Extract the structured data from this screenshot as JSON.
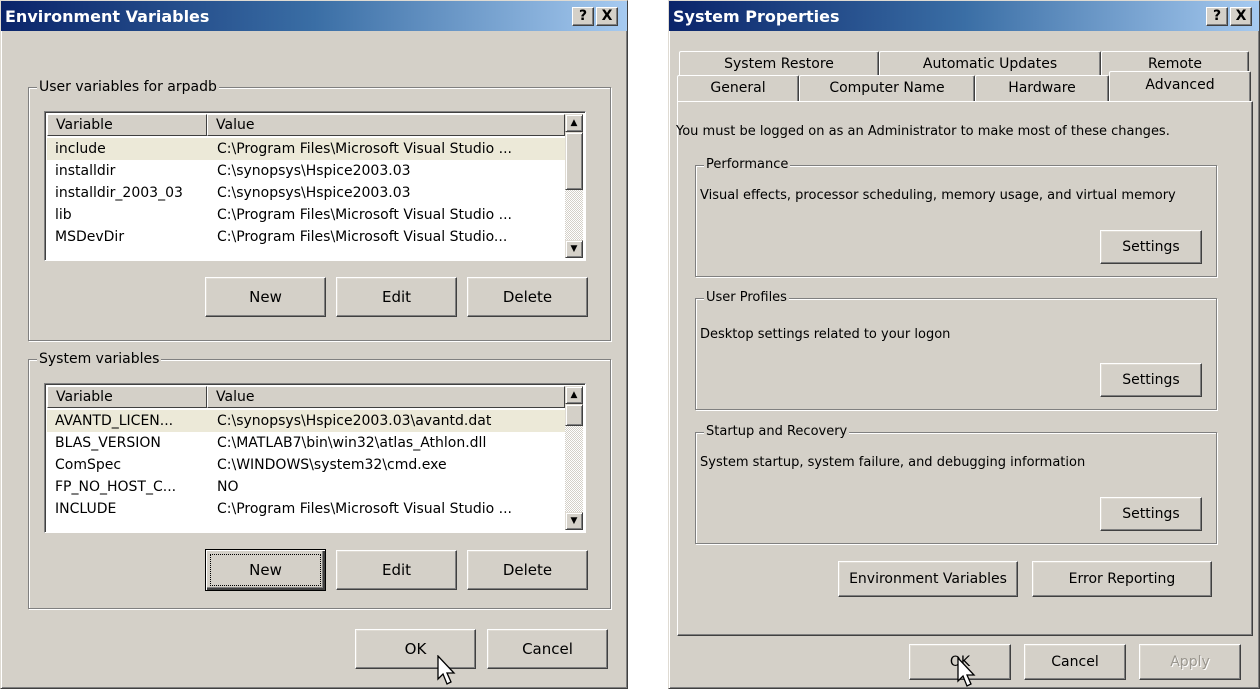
{
  "env_dialog": {
    "title": "Environment Variables",
    "help_btn": "?",
    "close_btn": "X",
    "user_group": {
      "label": "User variables for arpadb",
      "col_variable": "Variable",
      "col_value": "Value",
      "rows": [
        {
          "variable": "include",
          "value": "C:\\Program Files\\Microsoft Visual Studio ..."
        },
        {
          "variable": "installdir",
          "value": "C:\\synopsys\\Hspice2003.03"
        },
        {
          "variable": "installdir_2003_03",
          "value": "C:\\synopsys\\Hspice2003.03"
        },
        {
          "variable": "lib",
          "value": "C:\\Program Files\\Microsoft Visual Studio ..."
        },
        {
          "variable": "MSDevDir",
          "value": "C:\\Program Files\\Microsoft Visual Studio..."
        }
      ],
      "new_btn": "New",
      "edit_btn": "Edit",
      "delete_btn": "Delete"
    },
    "system_group": {
      "label": "System variables",
      "col_variable": "Variable",
      "col_value": "Value",
      "rows": [
        {
          "variable": "AVANTD_LICEN...",
          "value": "C:\\synopsys\\Hspice2003.03\\avantd.dat"
        },
        {
          "variable": "BLAS_VERSION",
          "value": "C:\\MATLAB7\\bin\\win32\\atlas_Athlon.dll"
        },
        {
          "variable": "ComSpec",
          "value": "C:\\WINDOWS\\system32\\cmd.exe"
        },
        {
          "variable": "FP_NO_HOST_C...",
          "value": "NO"
        },
        {
          "variable": "INCLUDE",
          "value": "C:\\Program Files\\Microsoft Visual Studio ..."
        }
      ],
      "new_btn": "New",
      "edit_btn": "Edit",
      "delete_btn": "Delete"
    },
    "ok_btn": "OK",
    "cancel_btn": "Cancel"
  },
  "sys_dialog": {
    "title": "System Properties",
    "help_btn": "?",
    "close_btn": "X",
    "tabs_row1": [
      "System Restore",
      "Automatic Updates",
      "Remote"
    ],
    "tabs_row2": [
      "General",
      "Computer Name",
      "Hardware",
      "Advanced"
    ],
    "active_tab": "Advanced",
    "admin_notice": "You must be logged on as an Administrator to make most of these changes.",
    "performance": {
      "label": "Performance",
      "desc": "Visual effects, processor scheduling, memory usage, and virtual memory",
      "btn": "Settings"
    },
    "user_profiles": {
      "label": "User Profiles",
      "desc": "Desktop settings related to your logon",
      "btn": "Settings"
    },
    "startup": {
      "label": "Startup and Recovery",
      "desc": "System startup, system failure, and debugging information",
      "btn": "Settings"
    },
    "env_vars_btn": "Environment Variables",
    "error_reporting_btn": "Error Reporting",
    "ok_btn": "OK",
    "cancel_btn": "Cancel",
    "apply_btn": "Apply"
  },
  "colors": {
    "title_active": "#0a246a",
    "face": "#d4d0c8",
    "selection": "#ece9d8"
  },
  "icons": [
    "help-icon",
    "close-icon",
    "scroll-up-icon",
    "scroll-down-icon",
    "mouse-pointer-icon"
  ]
}
